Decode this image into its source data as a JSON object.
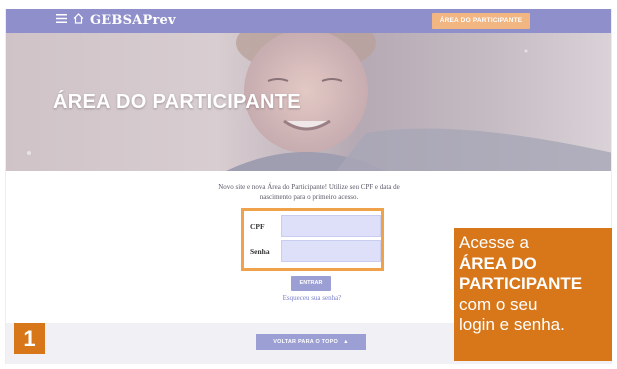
{
  "navbar": {
    "menu_icon": "menu-icon",
    "home_icon": "home-icon",
    "brand": "GEBSAPrev",
    "participant_button": "ÁREA DO PARTICIPANTE"
  },
  "hero": {
    "title": "ÁREA DO PARTICIPANTE"
  },
  "login": {
    "intro": "Novo site e nova Área do Participante! Utilize seu CPF e data de nascimento para o primeiro acesso.",
    "cpf_label": "CPF",
    "cpf_value": "",
    "senha_label": "Senha",
    "senha_value": "",
    "submit_label": "ENTRAR",
    "forgot_link": "Esqueceu sua senha?",
    "back_to_top": "VOLTAR PARA O TOPO"
  },
  "callout": {
    "line1": "Acesse a",
    "line2": "ÁREA DO",
    "line3": "PARTICIPANTE",
    "line4": "com o seu",
    "line5": "login e senha."
  },
  "step": {
    "number": "1"
  },
  "colors": {
    "navbar": "#8e8fcb",
    "accent_orange": "#d7771a",
    "button_purple": "#9c9fd3",
    "input_bg": "#dde0f8"
  }
}
